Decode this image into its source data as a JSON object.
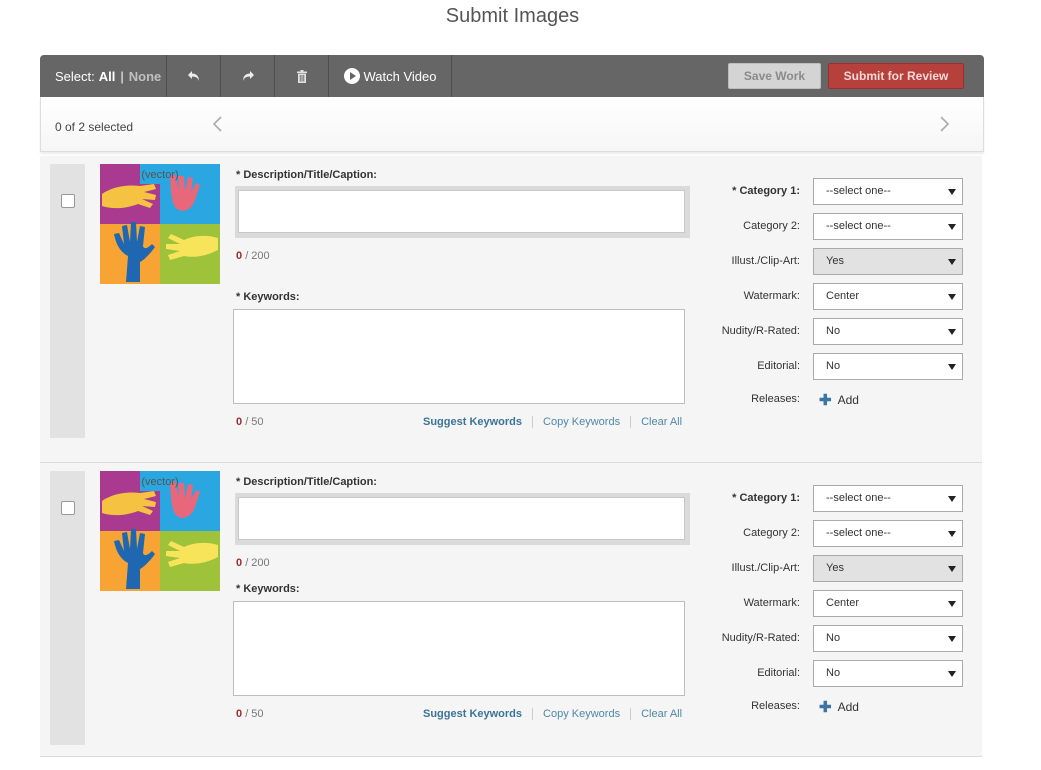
{
  "page": {
    "title": "Submit Images"
  },
  "toolbar": {
    "select_label": "Select:",
    "select_all": "All",
    "select_sep": "|",
    "select_none": "None",
    "watch_video": "Watch Video",
    "save_work": "Save Work",
    "submit_review": "Submit for Review"
  },
  "selection": {
    "count_text": "0 of 2 selected"
  },
  "labels": {
    "description": "* Description/Title/Caption:",
    "keywords": "* Keywords:",
    "category1": "* Category 1:",
    "category2": "Category 2:",
    "illust": "Illust./Clip-Art:",
    "watermark": "Watermark:",
    "nudity": "Nudity/R-Rated:",
    "editorial": "Editorial:",
    "releases": "Releases:",
    "add": "Add",
    "suggest_keywords": "Suggest Keywords",
    "copy_keywords": "Copy Keywords",
    "clear_all": "Clear All",
    "vector_tag": "(vector)"
  },
  "images": [
    {
      "description": "",
      "desc_count": "0",
      "desc_max": "/ 200",
      "keywords": "",
      "kw_count": "0",
      "kw_max": "/ 50",
      "category1": "--select one--",
      "category2": "--select one--",
      "illust": "Yes",
      "watermark": "Center",
      "nudity": "No",
      "editorial": "No"
    },
    {
      "description": "",
      "desc_count": "0",
      "desc_max": "/ 200",
      "keywords": "",
      "kw_count": "0",
      "kw_max": "/ 50",
      "category1": "--select one--",
      "category2": "--select one--",
      "illust": "Yes",
      "watermark": "Center",
      "nudity": "No",
      "editorial": "No"
    }
  ],
  "colors": {
    "toolbar_bg": "#666666",
    "submit_red": "#b6403b",
    "link_blue": "#3b7496",
    "required_red": "#9b2c2c"
  }
}
